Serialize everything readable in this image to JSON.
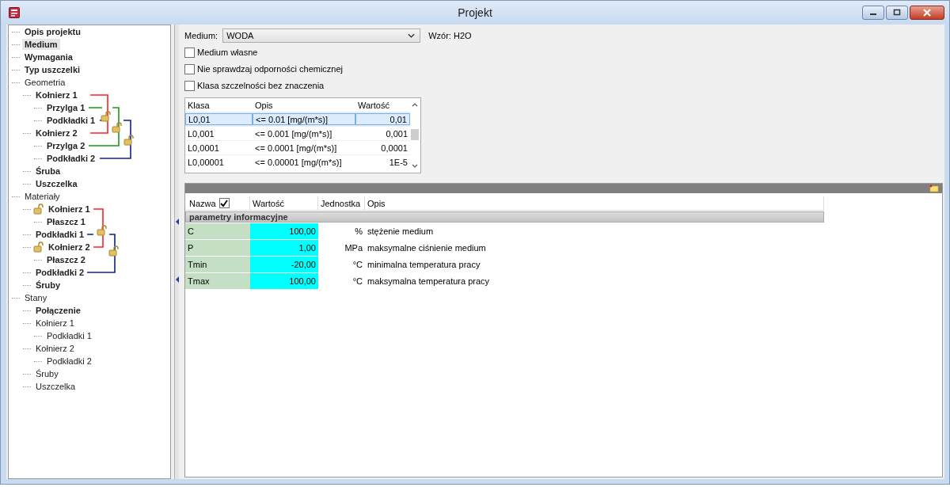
{
  "window": {
    "title": "Projekt"
  },
  "tree": [
    {
      "label": "Opis projektu",
      "bold": true,
      "selected": false
    },
    {
      "label": "Medium",
      "bold": true,
      "selected": true
    },
    {
      "label": "Wymagania",
      "bold": true,
      "selected": false
    },
    {
      "label": "Typ uszczelki",
      "bold": true,
      "selected": false
    },
    {
      "label": "Geometria",
      "bold": false,
      "selected": false,
      "children": [
        {
          "label": "Kołnierz 1",
          "bold": true,
          "selected": false,
          "children": [
            {
              "label": "Przylga 1",
              "bold": true,
              "selected": false
            },
            {
              "label": "Podkładki 1",
              "bold": true,
              "selected": false
            }
          ]
        },
        {
          "label": "Kołnierz 2",
          "bold": true,
          "selected": false,
          "children": [
            {
              "label": "Przylga 2",
              "bold": true,
              "selected": false
            },
            {
              "label": "Podkładki 2",
              "bold": true,
              "selected": false
            }
          ]
        },
        {
          "label": "Śruba",
          "bold": true,
          "selected": false
        },
        {
          "label": "Uszczelka",
          "bold": true,
          "selected": false
        }
      ]
    },
    {
      "label": "Materiały",
      "bold": false,
      "selected": false,
      "children": [
        {
          "label": "Kołnierz 1",
          "bold": true,
          "selected": false,
          "lock": true,
          "children": [
            {
              "label": "Płaszcz 1",
              "bold": true,
              "selected": false
            }
          ]
        },
        {
          "label": "Podkładki 1",
          "bold": true,
          "selected": false,
          "lock": false
        },
        {
          "label": "Kołnierz 2",
          "bold": true,
          "selected": false,
          "lock": true,
          "children": [
            {
              "label": "Płaszcz 2",
              "bold": true,
              "selected": false
            }
          ]
        },
        {
          "label": "Podkładki 2",
          "bold": true,
          "selected": false,
          "lock": false
        },
        {
          "label": "Śruby",
          "bold": true,
          "selected": false,
          "lock": false
        }
      ]
    },
    {
      "label": "Stany",
      "bold": false,
      "selected": false,
      "children": [
        {
          "label": "Połączenie",
          "bold": true,
          "selected": false
        },
        {
          "label": "Kołnierz 1",
          "bold": false,
          "selected": false,
          "children": [
            {
              "label": "Podkładki 1",
              "bold": false,
              "selected": false
            }
          ]
        },
        {
          "label": "Kołnierz 2",
          "bold": false,
          "selected": false,
          "children": [
            {
              "label": "Podkładki 2",
              "bold": false,
              "selected": false
            }
          ]
        },
        {
          "label": "Śruby",
          "bold": false,
          "selected": false
        },
        {
          "label": "Uszczelka",
          "bold": false,
          "selected": false
        }
      ]
    }
  ],
  "medium": {
    "label": "Medium:",
    "value": "WODA",
    "formula": "Wzór: H2O"
  },
  "options": [
    {
      "label": "Medium własne",
      "checked": false
    },
    {
      "label": "Nie sprawdzaj odporności chemicznej",
      "checked": false
    },
    {
      "label": "Klasa szczelności bez znaczenia",
      "checked": false
    }
  ],
  "leak_classes": {
    "columns": [
      "Klasa",
      "Opis",
      "Wartość"
    ],
    "rows": [
      {
        "cells": [
          "L0,01",
          "<= 0.01 [mg/(m*s)]",
          "0,01"
        ],
        "selected": true
      },
      {
        "cells": [
          "L0,001",
          "<= 0.001 [mg/(m*s)]",
          "0,001"
        ],
        "selected": false
      },
      {
        "cells": [
          "L0,0001",
          "<= 0.0001 [mg/(m*s)]",
          "0,0001"
        ],
        "selected": false
      },
      {
        "cells": [
          "L0,00001",
          "<= 0.00001 [mg/(m*s)]",
          "1E-5"
        ],
        "selected": false
      }
    ]
  },
  "parameters": {
    "columns": [
      "Nazwa",
      "Wartość",
      "Jednostka",
      "Opis"
    ],
    "name_checked": true,
    "group": "parametry informacyjne",
    "rows": [
      {
        "name": "C",
        "value": "100,00",
        "unit": "%",
        "description": "stężenie medium"
      },
      {
        "name": "P",
        "value": "1,00",
        "unit": "MPa",
        "description": "maksymalne ciśnienie medium"
      },
      {
        "name": "Tmin",
        "value": "-20,00",
        "unit": "°C",
        "description": "minimalna temperatura pracy"
      },
      {
        "name": "Tmax",
        "value": "100,00",
        "unit": "°C",
        "description": "maksymalna temperatura pracy"
      }
    ]
  }
}
